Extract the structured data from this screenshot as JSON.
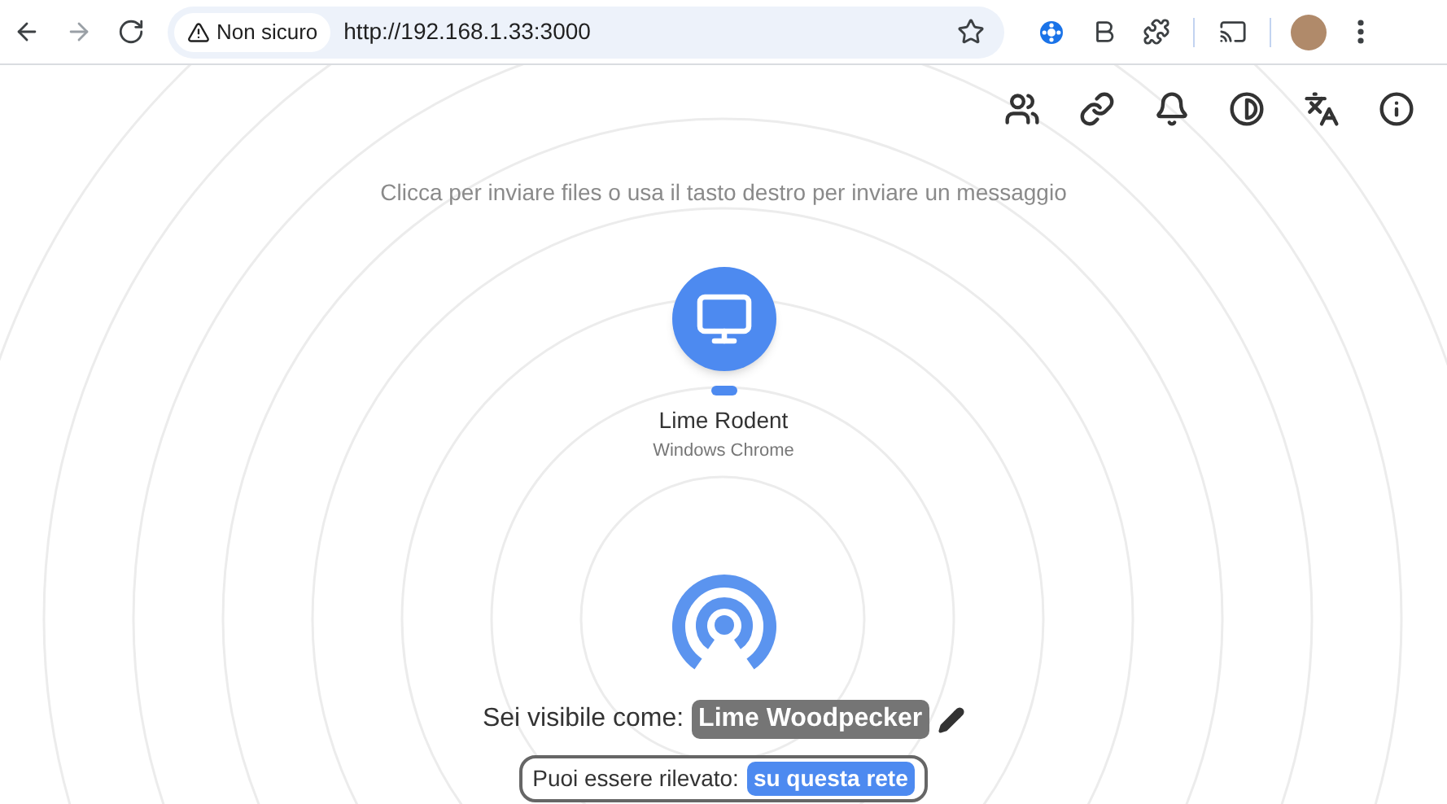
{
  "browser": {
    "security_label": "Non sicuro",
    "url": "http://192.168.1.33:3000"
  },
  "hint": "Clicca per inviare files o usa il tasto destro per inviare un messaggio",
  "peers": [
    {
      "name": "Lime Rodent",
      "device": "Windows Chrome"
    }
  ],
  "self": {
    "visible_label": "Sei visibile come:",
    "display_name": "Lime Woodpecker",
    "discovery_label": "Puoi essere rilevato:",
    "discovery_value": "su questa rete"
  }
}
